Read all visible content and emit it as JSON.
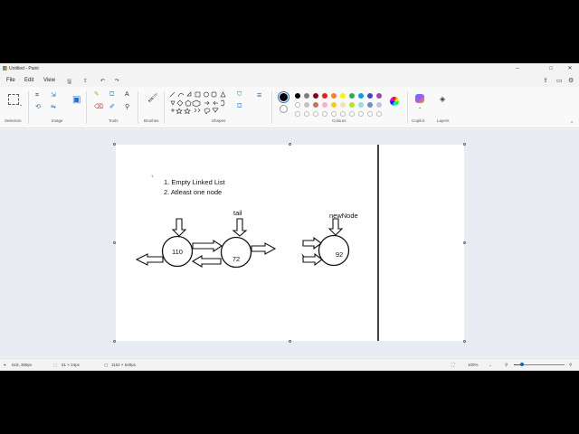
{
  "window": {
    "title": "Untitled - Paint"
  },
  "menu": {
    "items": [
      "File",
      "Edit",
      "View"
    ]
  },
  "ribbon": {
    "groups": [
      "Selection",
      "Image",
      "Tools",
      "Brushes",
      "Shapes",
      "Colours",
      "Copilot",
      "Layers"
    ],
    "palette_row1": [
      "#000000",
      "#7f7f7f",
      "#880015",
      "#ed1c24",
      "#ff7f27",
      "#fff200",
      "#22b14c",
      "#00a2e8",
      "#3f48cc",
      "#a349a4"
    ],
    "palette_row2": [
      "#ffffff",
      "#c3c3c3",
      "#b97a57",
      "#ffaec9",
      "#ffc90e",
      "#efe4b0",
      "#b5e61d",
      "#99d9ea",
      "#7092be",
      "#c8bfe7"
    ]
  },
  "canvas": {
    "list_marker": "1",
    "list": [
      "1. Empty Linked List",
      "2. Atleast one node"
    ],
    "labels": {
      "tail": "tail",
      "newnode": "newNode"
    },
    "nodes": {
      "n1": "110",
      "n2": "72",
      "n3": "92"
    }
  },
  "status": {
    "cursor": "618, 368px",
    "selection": "51 × 24px",
    "canvas_size": "1152 × 648px",
    "zoom": "100%",
    "zoom_level": 0.16
  }
}
